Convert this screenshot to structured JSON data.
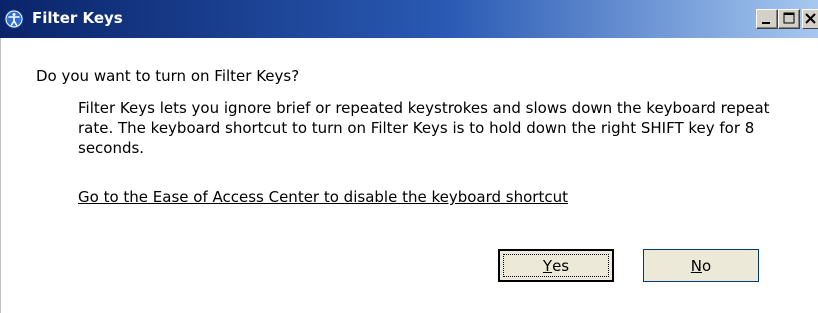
{
  "window": {
    "title": "Filter Keys",
    "controls": {
      "minimize_icon": "minimize-icon",
      "maximize_icon": "maximize-icon",
      "close_icon": "close-icon"
    },
    "title_icon": "ease-of-access-icon"
  },
  "content": {
    "question": "Do you want to turn on Filter Keys?",
    "description": "Filter Keys lets you ignore brief or repeated keystrokes and slows down the keyboard repeat rate.  The keyboard shortcut to turn on Filter Keys is to hold down the right SHIFT key for 8 seconds.",
    "link": "Go to the Ease of Access Center to disable the keyboard shortcut"
  },
  "buttons": {
    "yes": {
      "mnemonic": "Y",
      "rest": "es"
    },
    "no": {
      "mnemonic": "N",
      "rest": "o"
    }
  },
  "colors": {
    "titlebar_start": "#0a246a",
    "titlebar_end": "#a6c8f0",
    "button_face": "#ece9d8"
  }
}
